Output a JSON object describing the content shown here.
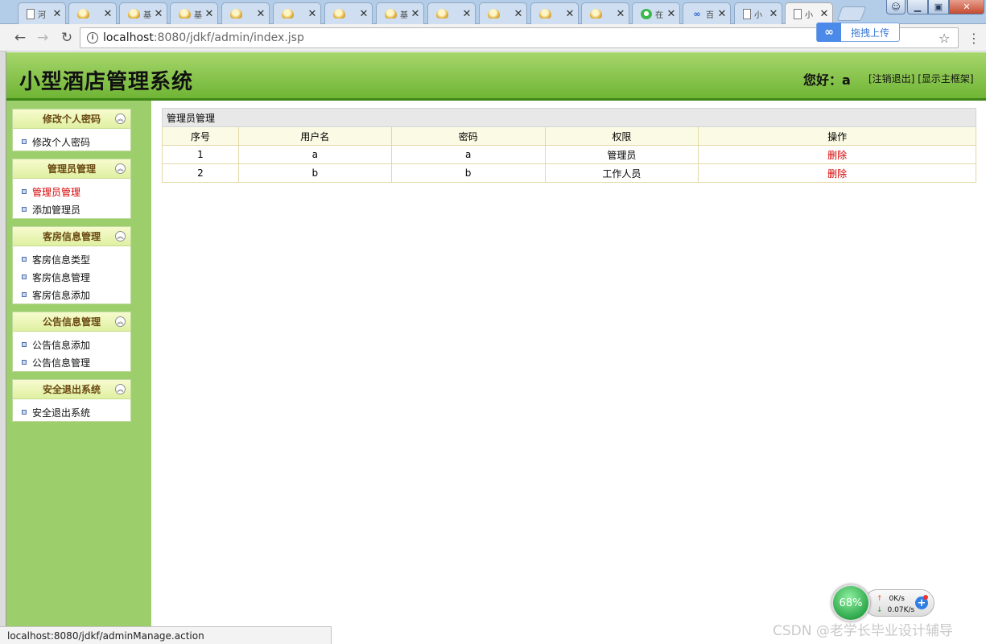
{
  "browser": {
    "tabs": [
      {
        "icon": "doc-icon",
        "title": "河"
      },
      {
        "icon": "lamp-icon",
        "title": ""
      },
      {
        "icon": "lamp-icon",
        "title": "基"
      },
      {
        "icon": "lamp-icon",
        "title": "基"
      },
      {
        "icon": "lamp-icon",
        "title": ""
      },
      {
        "icon": "lamp-icon",
        "title": ""
      },
      {
        "icon": "lamp-icon",
        "title": ""
      },
      {
        "icon": "lamp-icon",
        "title": "基"
      },
      {
        "icon": "lamp-icon",
        "title": ""
      },
      {
        "icon": "lamp-icon",
        "title": ""
      },
      {
        "icon": "lamp-icon",
        "title": ""
      },
      {
        "icon": "lamp-icon",
        "title": ""
      },
      {
        "icon": "chat-icon",
        "title": "在"
      },
      {
        "icon": "baidu-icon",
        "title": "百"
      },
      {
        "icon": "doc-icon",
        "title": "小"
      },
      {
        "icon": "doc-icon",
        "title": "小"
      }
    ],
    "url_host": "localhost",
    "url_rest": ":8080/jdkf/admin/index.jsp",
    "upload_label": "拖拽上传",
    "status_url": "localhost:8080/jdkf/adminManage.action"
  },
  "header": {
    "title": "小型酒店管理系统",
    "greeting": "您好：a",
    "logout_link": "[注销退出]",
    "show_frame_link": "[显示主框架]"
  },
  "sidebar": {
    "groups": [
      {
        "title": "修改个人密码",
        "items": [
          "修改个人密码"
        ]
      },
      {
        "title": "管理员管理",
        "items": [
          "管理员管理",
          "添加管理员"
        ]
      },
      {
        "title": "客房信息管理",
        "items": [
          "客房信息类型",
          "客房信息管理",
          "客房信息添加"
        ]
      },
      {
        "title": "公告信息管理",
        "items": [
          "公告信息添加",
          "公告信息管理"
        ]
      },
      {
        "title": "安全退出系统",
        "items": [
          "安全退出系统"
        ]
      }
    ]
  },
  "table": {
    "caption": "管理员管理",
    "columns": [
      "序号",
      "用户名",
      "密码",
      "权限",
      "操作"
    ],
    "rows": [
      {
        "id": "1",
        "username": "a",
        "password": "a",
        "role": "管理员",
        "action": "删除"
      },
      {
        "id": "2",
        "username": "b",
        "password": "b",
        "role": "工作人员",
        "action": "删除"
      }
    ]
  },
  "widget": {
    "percent": "68%",
    "upload_speed": "0K/s",
    "download_speed": "0.07K/s"
  },
  "watermark": "CSDN @老学长毕业设计辅导"
}
